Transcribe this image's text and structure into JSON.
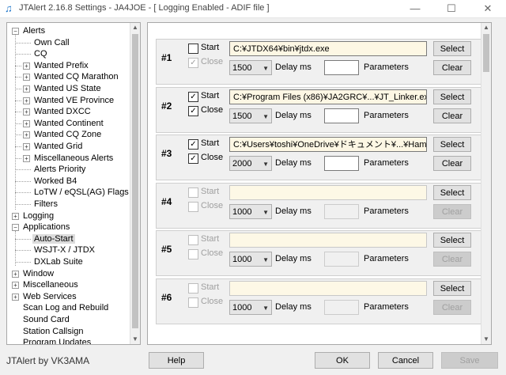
{
  "window": {
    "title": "JTAlert 2.16.8 Settings  -  JA4JOE  -  [ Logging Enabled - ADIF file ]",
    "minimize_glyph": "—",
    "maximize_glyph": "☐",
    "close_glyph": "✕"
  },
  "tree": {
    "items": [
      {
        "label": "Alerts",
        "expander": "⊟"
      },
      {
        "label": "Own Call"
      },
      {
        "label": "CQ"
      },
      {
        "label": "Wanted Prefix",
        "expander": "⊞"
      },
      {
        "label": "Wanted CQ Marathon",
        "expander": "⊞"
      },
      {
        "label": "Wanted US State",
        "expander": "⊞"
      },
      {
        "label": "Wanted VE Province",
        "expander": "⊞"
      },
      {
        "label": "Wanted DXCC",
        "expander": "⊞"
      },
      {
        "label": "Wanted Continent",
        "expander": "⊞"
      },
      {
        "label": "Wanted CQ Zone",
        "expander": "⊞"
      },
      {
        "label": "Wanted Grid",
        "expander": "⊞"
      },
      {
        "label": "Miscellaneous Alerts",
        "expander": "⊞"
      },
      {
        "label": "Alerts Priority"
      },
      {
        "label": "Worked B4"
      },
      {
        "label": "LoTW / eQSL(AG) Flags"
      },
      {
        "label": "Filters"
      },
      {
        "label": "Logging",
        "expander": "⊞"
      },
      {
        "label": "Applications",
        "expander": "⊟"
      },
      {
        "label": "Auto-Start",
        "selected": true
      },
      {
        "label": "WSJT-X / JTDX"
      },
      {
        "label": "DXLab Suite"
      },
      {
        "label": "Window",
        "expander": "⊞"
      },
      {
        "label": "Miscellaneous",
        "expander": "⊞"
      },
      {
        "label": "Web Services",
        "expander": "⊞"
      },
      {
        "label": "Scan Log and Rebuild"
      },
      {
        "label": "Sound Card"
      },
      {
        "label": "Station Callsign"
      },
      {
        "label": "Program Updates"
      }
    ]
  },
  "labels": {
    "start": "Start",
    "close": "Close",
    "delay": "Delay ms",
    "parameters": "Parameters",
    "select": "Select",
    "clear": "Clear",
    "check_mark": "✓"
  },
  "apps": [
    {
      "num": "#1",
      "start": false,
      "close": true,
      "enabled": true,
      "close_enabled": false,
      "path": "C:¥JTDX64¥bin¥jtdx.exe",
      "delay": "1500"
    },
    {
      "num": "#2",
      "start": true,
      "close": true,
      "enabled": true,
      "close_enabled": true,
      "path": "C:¥Program Files (x86)¥JA2GRC¥...¥JT_Linker.exe",
      "delay": "1500"
    },
    {
      "num": "#3",
      "start": true,
      "close": true,
      "enabled": true,
      "close_enabled": true,
      "path": "C:¥Users¥toshi¥OneDrive¥ドキュメント¥...¥Hamlogw.",
      "delay": "2000"
    },
    {
      "num": "#4",
      "start": false,
      "close": false,
      "enabled": false,
      "close_enabled": false,
      "path": "",
      "delay": "1000"
    },
    {
      "num": "#5",
      "start": false,
      "close": false,
      "enabled": false,
      "close_enabled": false,
      "path": "",
      "delay": "1000"
    },
    {
      "num": "#6",
      "start": false,
      "close": false,
      "enabled": false,
      "close_enabled": false,
      "path": "",
      "delay": "1000"
    }
  ],
  "footer": {
    "credit": "JTAlert by VK3AMA",
    "help": "Help",
    "ok": "OK",
    "cancel": "Cancel",
    "save": "Save"
  }
}
